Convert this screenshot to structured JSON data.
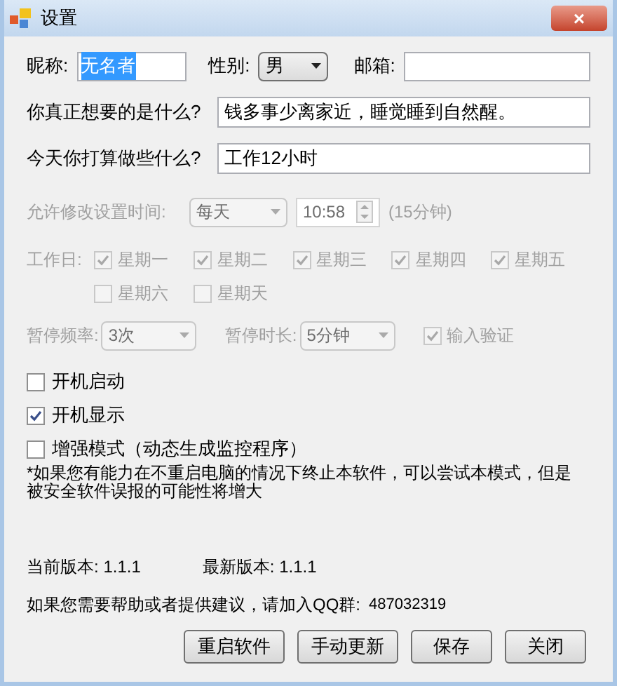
{
  "window": {
    "title": "设置",
    "close": "×"
  },
  "profile": {
    "nickname": {
      "label": "昵称:",
      "value": "无名者",
      "selected": true
    },
    "gender": {
      "label": "性别:",
      "value": "男"
    },
    "email": {
      "label": "邮箱:"
    }
  },
  "questions": [
    {
      "label": "你真正想要的是什么?",
      "value": "钱多事少离家近，睡觉睡到自然醒。"
    },
    {
      "label": "今天你打算做些什么?",
      "value": "工作12小时"
    }
  ],
  "schedule": {
    "disabled": true,
    "label": "允许修改设置时间:",
    "period": "每天",
    "time": "10:58",
    "note": "(15分钟)",
    "workdays_label": "工作日:",
    "workdays": [
      {
        "label": "星期一",
        "checked": true
      },
      {
        "label": "星期二",
        "checked": true
      },
      {
        "label": "星期三",
        "checked": true
      },
      {
        "label": "星期四",
        "checked": true
      },
      {
        "label": "星期五",
        "checked": true
      },
      {
        "label": "星期六",
        "checked": false
      },
      {
        "label": "星期天",
        "checked": false
      }
    ],
    "pause_frequency": {
      "label": "暂停频率:",
      "value": "3次"
    },
    "pause_duration": {
      "label": "暂停时长:",
      "value": "5分钟"
    },
    "verify": {
      "label": "输入验证",
      "checked": true
    }
  },
  "options": [
    {
      "label": "开机启动",
      "checked": false
    },
    {
      "label": "开机显示",
      "checked": true
    },
    {
      "label": "增强模式（动态生成监控程序）",
      "checked": false
    }
  ],
  "note": "*如果您有能力在不重启电脑的情况下终止本软件，可以尝试本模式，但是被安全软件误报的可能性将增大",
  "version": {
    "current_label": "当前版本:",
    "current": "1.1.1",
    "latest_label": "最新版本:",
    "latest": "1.1.1"
  },
  "help": {
    "text": "如果您需要帮助或者提供建议，请加入QQ群:",
    "qq": "487032319"
  },
  "buttons": [
    "重启软件",
    "手动更新",
    "保存",
    "关闭"
  ]
}
